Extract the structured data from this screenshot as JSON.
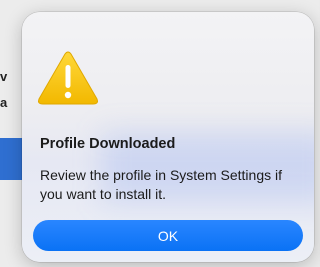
{
  "background": {
    "fragment_1": "v",
    "fragment_2": "a"
  },
  "alert": {
    "icon": "warning-triangle-icon",
    "title": "Profile Downloaded",
    "message": "Review the profile in System Settings if you want to install it.",
    "ok_label": "OK",
    "accent_color": "#0a72f5",
    "icon_color": "#f5c400"
  }
}
